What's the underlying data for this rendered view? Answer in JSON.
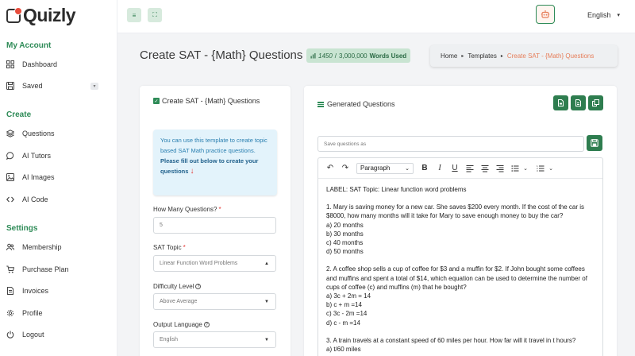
{
  "app": {
    "brand": "Quizly",
    "accent": "#2e8b57",
    "alert": "#e67e5a"
  },
  "header": {
    "language": "English"
  },
  "sidebar": {
    "sections": [
      {
        "title": "My Account",
        "items": [
          {
            "label": "Dashboard",
            "icon": "grid-icon"
          },
          {
            "label": "Saved",
            "icon": "floppy-icon"
          }
        ]
      },
      {
        "title": "Create",
        "items": [
          {
            "label": "Questions",
            "icon": "layers-icon"
          },
          {
            "label": "AI Tutors",
            "icon": "chat-bubble-icon"
          },
          {
            "label": "AI Images",
            "icon": "image-icon"
          },
          {
            "label": "AI Code",
            "icon": "code-icon"
          }
        ]
      },
      {
        "title": "Settings",
        "items": [
          {
            "label": "Membership",
            "icon": "users-icon"
          },
          {
            "label": "Purchase Plan",
            "icon": "cart-icon"
          },
          {
            "label": "Invoices",
            "icon": "document-icon"
          },
          {
            "label": "Profile",
            "icon": "gear-icon"
          },
          {
            "label": "Logout",
            "icon": "power-icon"
          }
        ]
      }
    ]
  },
  "page": {
    "title": "Create SAT - {Math} Questions",
    "words_used": "1450",
    "words_total": "3,000,000",
    "words_label": "Words Used",
    "breadcrumb": [
      "Home",
      "Templates",
      "Create SAT - {Math} Questions"
    ]
  },
  "form": {
    "card_title": "Create SAT - {Math} Questions",
    "info_text": "You can use this template to create topic based SAT Math practice questions.",
    "info_bold": "Please fill out below to create your questions",
    "questions_label": "How Many Questions?",
    "questions_value": "5",
    "topic_label": "SAT Topic",
    "topic_value": "Linear Function Word Problems",
    "difficulty_label": "Difficulty Level",
    "difficulty_value": "Above Average",
    "language_label": "Output Language",
    "language_value": "English"
  },
  "generated": {
    "title": "Generated Questions",
    "save_placeholder": "Save questions as",
    "toolbar_paragraph": "Paragraph",
    "lines": [
      [
        "LABEL: SAT Topic: Linear function word problems"
      ],
      [
        "1. Mary is saving money for a new car. She saves $200 every month. If the cost of the car is",
        "$8000, how many months will it take for Mary to save enough money to buy the car?",
        "a) 20 months",
        "b) 30 months",
        "c) 40 months",
        "d) 50 months"
      ],
      [
        "2. A coffee shop sells a cup of coffee for $3 and a muffin for $2. If John bought some coffees",
        "and muffins and spent a total of $14, which equation can be used to determine the number of",
        "cups of coffee (c) and muffins (m) that he bought?",
        "a) 3c + 2m = 14",
        "b) c + m =14",
        "c) 3c - 2m =14",
        "d) c - m =14"
      ],
      [
        "3. A train travels at a constant speed of 60 miles per hour. How far will it travel in t hours?",
        "a) t/60 miles"
      ]
    ]
  }
}
